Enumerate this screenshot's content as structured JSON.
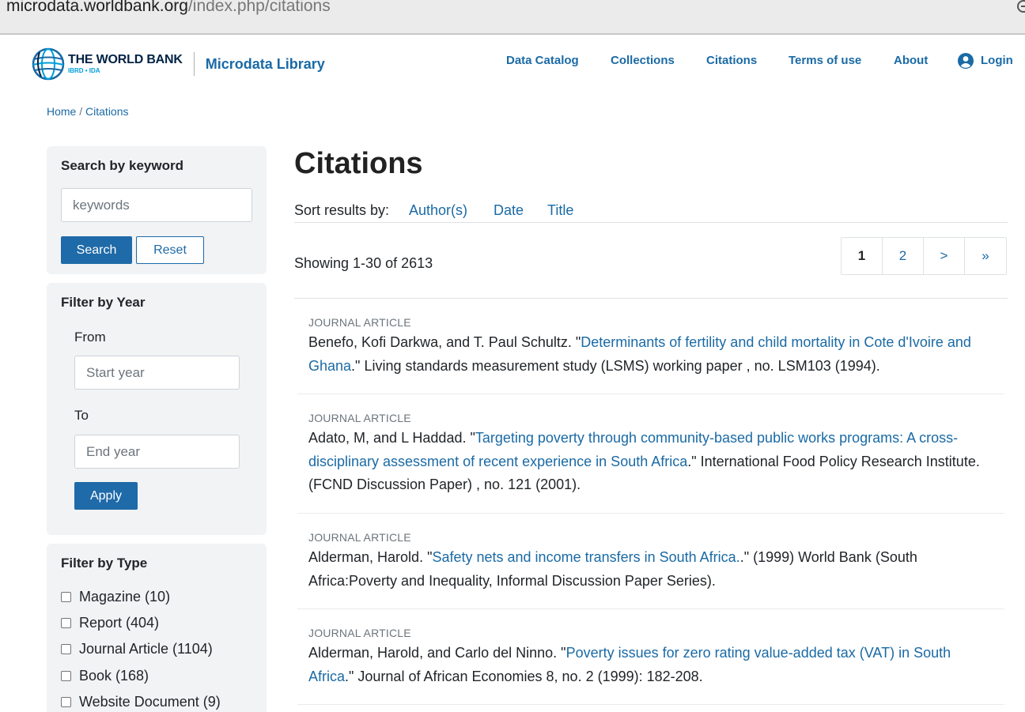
{
  "browser": {
    "url_domain": "microdata.worldbank.org",
    "url_path": "/index.php/citations"
  },
  "header": {
    "logo_title": "THE WORLD BANK",
    "logo_subtitle": "IBRD • IDA",
    "library_name": "Microdata Library",
    "nav": [
      "Data Catalog",
      "Collections",
      "Citations",
      "Terms of use",
      "About"
    ],
    "login_label": "Login"
  },
  "breadcrumb": {
    "home": "Home",
    "separator": "/",
    "current": "Citations"
  },
  "sidebar": {
    "keyword": {
      "title": "Search by keyword",
      "placeholder": "keywords",
      "search_label": "Search",
      "reset_label": "Reset"
    },
    "year": {
      "title": "Filter by Year",
      "from_label": "From",
      "from_placeholder": "Start year",
      "to_label": "To",
      "to_placeholder": "End year",
      "apply_label": "Apply"
    },
    "type": {
      "title": "Filter by Type",
      "items": [
        "Magazine (10)",
        "Report (404)",
        "Journal Article (1104)",
        "Book (168)",
        "Website Document (9)"
      ]
    }
  },
  "main": {
    "title": "Citations",
    "sort_label": "Sort results by:",
    "sort_options": [
      "Author(s)",
      "Date",
      "Title"
    ],
    "showing": "Showing 1-30 of 2613",
    "pagination": [
      "1",
      "2",
      ">",
      "»"
    ],
    "citations": [
      {
        "type": "JOURNAL ARTICLE",
        "authors": "Benefo, Kofi Darkwa, and T. Paul Schultz. \"",
        "title": "Determinants of fertility and child mortality in Cote d'Ivoire and Ghana",
        "rest": ".\" Living standards measurement study (LSMS) working paper , no. LSM103 (1994)."
      },
      {
        "type": "JOURNAL ARTICLE",
        "authors": "Adato, M, and L Haddad. \"",
        "title": "Targeting poverty through community-based public works programs: A cross-disciplinary assessment of recent experience in South Africa",
        "rest": ".\" International Food Policy Research Institute. (FCND Discussion Paper) , no. 121 (2001)."
      },
      {
        "type": "JOURNAL ARTICLE",
        "authors": "Alderman, Harold. \"",
        "title": "Safety nets and income transfers in South Africa.",
        "rest": ".\" (1999) World Bank (South Africa:Poverty and Inequality, Informal Discussion Paper Series)."
      },
      {
        "type": "JOURNAL ARTICLE",
        "authors": "Alderman, Harold, and Carlo del Ninno. \"",
        "title": "Poverty issues for zero rating value-added tax (VAT) in South Africa",
        "rest": ".\" Journal of African Economies 8, no. 2 (1999): 182-208."
      }
    ]
  },
  "colors": {
    "link": "#1a6aa5",
    "primary_button": "#1f6aa8",
    "panel_bg": "#f1f3f5"
  }
}
